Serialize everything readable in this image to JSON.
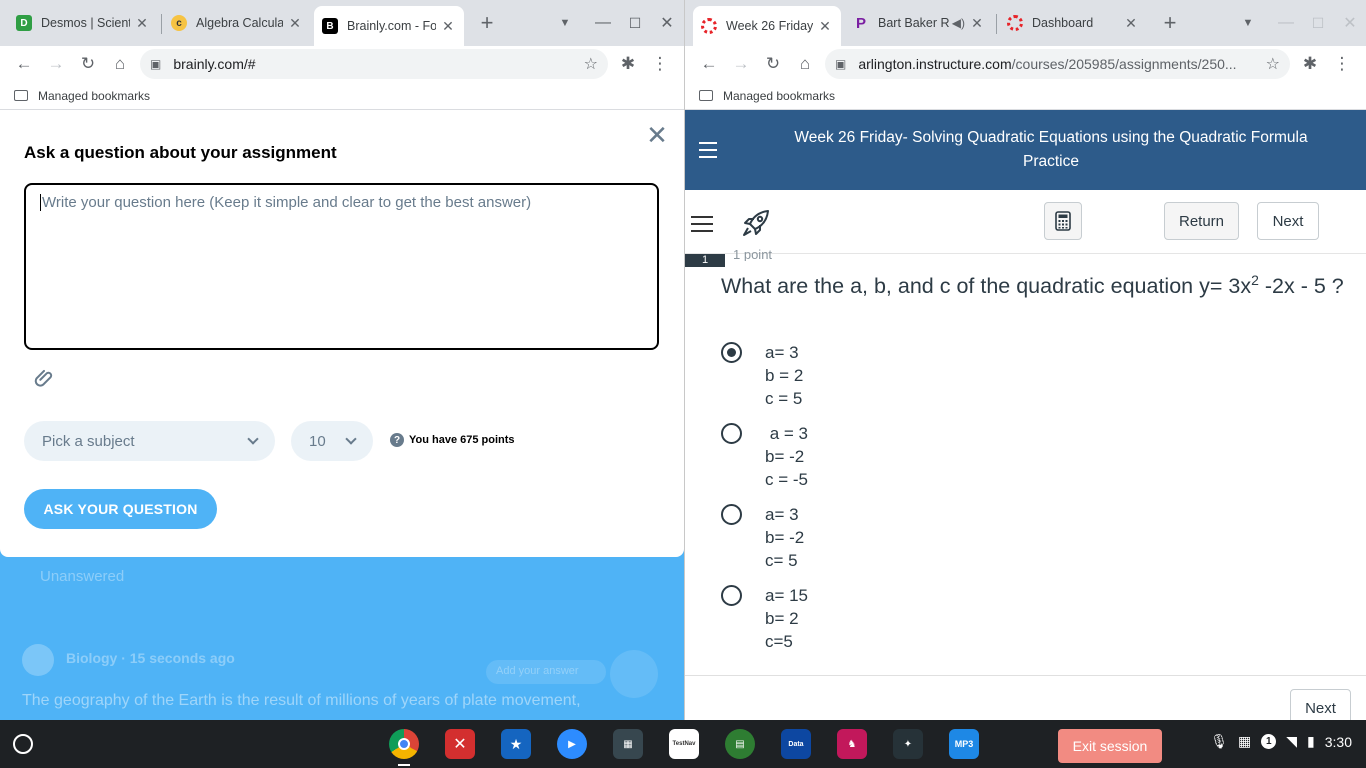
{
  "left_window": {
    "tabs": [
      {
        "title": "Desmos | Scient",
        "favicon_color": "#2f9e44",
        "favicon": "desmos-icon"
      },
      {
        "title": "Algebra Calculat",
        "favicon_color": "#f6c343",
        "favicon": "calculator-icon"
      },
      {
        "title": "Brainly.com - Fo",
        "favicon_color": "#000000",
        "favicon": "brainly-icon",
        "active": true
      }
    ],
    "url": "brainly.com/#",
    "bookmarks_label": "Managed bookmarks"
  },
  "right_window": {
    "tabs": [
      {
        "title": "Week 26 Friday-",
        "favicon_color": "#e72429",
        "favicon": "canvas-icon",
        "active": true
      },
      {
        "title": "Bart Baker R",
        "favicon_color": "#7b1fa2",
        "favicon": "pandora-icon",
        "audio": true
      },
      {
        "title": "Dashboard",
        "favicon_color": "#e72429",
        "favicon": "canvas-icon"
      }
    ],
    "url_host": "arlington.instructure.com",
    "url_path": "/courses/205985/assignments/250...",
    "bookmarks_label": "Managed bookmarks"
  },
  "brainly": {
    "modal_title": "Ask a question about your assignment",
    "question_placeholder": "Write your question here (Keep it simple and clear to get the best answer)",
    "subject_placeholder": "Pick a subject",
    "points_value": "10",
    "points_info": "You have 675 points",
    "ask_button": "ASK YOUR QUESTION",
    "background": {
      "filter_label": "Unanswered",
      "feed_meta": "Biology · 15 seconds ago",
      "feed_button": "Add your answer",
      "feed_text": "The geography of the Earth is the result of millions of years of plate movement,"
    }
  },
  "canvas": {
    "header_title": "Week 26 Friday- Solving Quadratic Equations using the Quadratic Formula Practice",
    "return_button": "Return",
    "next_button": "Next",
    "question_number": "1",
    "question_points": "1 point",
    "question_pre": "What are the a, b, and c of the quadratic equation y= 3x",
    "question_exp": "2",
    "question_post": " -2x - 5 ?",
    "answers": [
      {
        "text": "a= 3\nb = 2\nc = 5",
        "selected": true
      },
      {
        "text": " a = 3\nb= -2\nc = -5",
        "selected": false
      },
      {
        "text": "a= 3\nb= -2\nc= 5",
        "selected": false
      },
      {
        "text": "a= 15\nb= 2\nc=5",
        "selected": false
      }
    ],
    "footer_next": "Next"
  },
  "shelf": {
    "exit_session": "Exit session",
    "notification_count": "1",
    "time": "3:30",
    "apps": [
      {
        "name": "chrome-icon",
        "color": "#db4437"
      },
      {
        "name": "app-red-x-icon",
        "color": "#d32f2f"
      },
      {
        "name": "texas-flag-icon",
        "color": "#1565c0"
      },
      {
        "name": "zoom-icon",
        "color": "#2d8cff"
      },
      {
        "name": "app-folder-icon",
        "color": "#37474f"
      },
      {
        "name": "pearson-testnav-icon",
        "color": "#ffffff"
      },
      {
        "name": "app-green-icon",
        "color": "#2e7d32"
      },
      {
        "name": "data-manager-icon",
        "color": "#0d47a1"
      },
      {
        "name": "app-pink-icon",
        "color": "#c2185b"
      },
      {
        "name": "app-dark-icon",
        "color": "#263238"
      },
      {
        "name": "mp3-delivery-icon",
        "color": "#1e88e5"
      }
    ]
  }
}
